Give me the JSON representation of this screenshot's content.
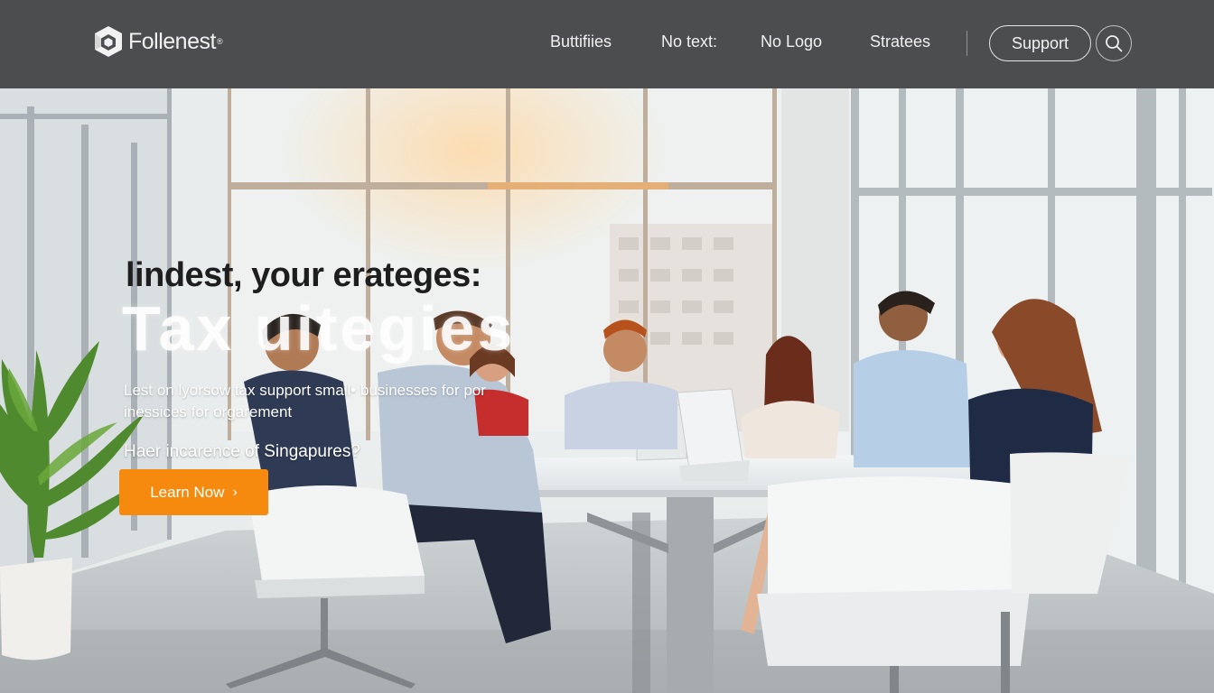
{
  "brand": {
    "name": "Follenest",
    "mark": "®"
  },
  "nav": {
    "links": [
      "Buttifiies",
      "No text:",
      "No Logo",
      "Stratees"
    ],
    "support_label": "Support"
  },
  "hero": {
    "headline": "lindest, your erateges:",
    "title": "Tax uitegies",
    "subtext": "Lest on lyorsow tax support small• businesses for por inessices for orgarement",
    "question": "Haer incarence of Singapures?",
    "cta_label": "Learn Now",
    "cta_chevron": "›"
  },
  "icons": [
    "logo-cube-icon",
    "search-icon",
    "chevron-right-icon"
  ],
  "colors": {
    "header_bg": "#4b4d4f",
    "accent": "#f58a0e",
    "text_light": "#f1f1f1"
  }
}
